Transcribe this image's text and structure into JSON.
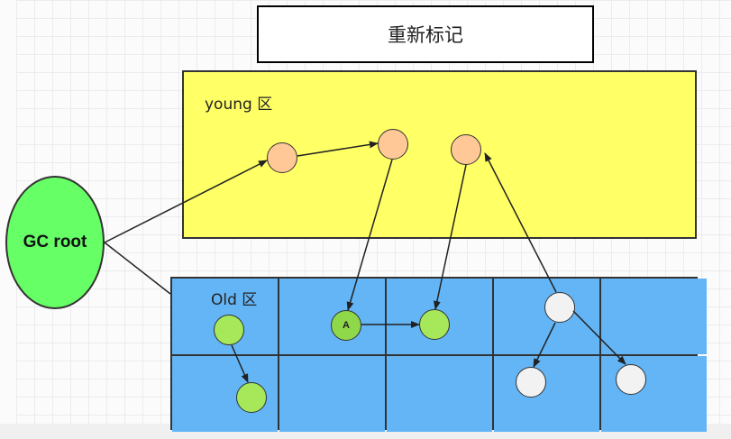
{
  "title": "重新标记",
  "regions": {
    "young_label": "young 区",
    "old_label": "Old 区"
  },
  "gc_root": "GC root",
  "node_a_label": "A",
  "colors": {
    "young_area": "#ffff66",
    "old_area": "#64b5f6",
    "gc_root": "#66ff66",
    "young_node": "#ffc896",
    "marked_node": "#a6e85a",
    "unmarked_node": "#f2f2f2"
  }
}
